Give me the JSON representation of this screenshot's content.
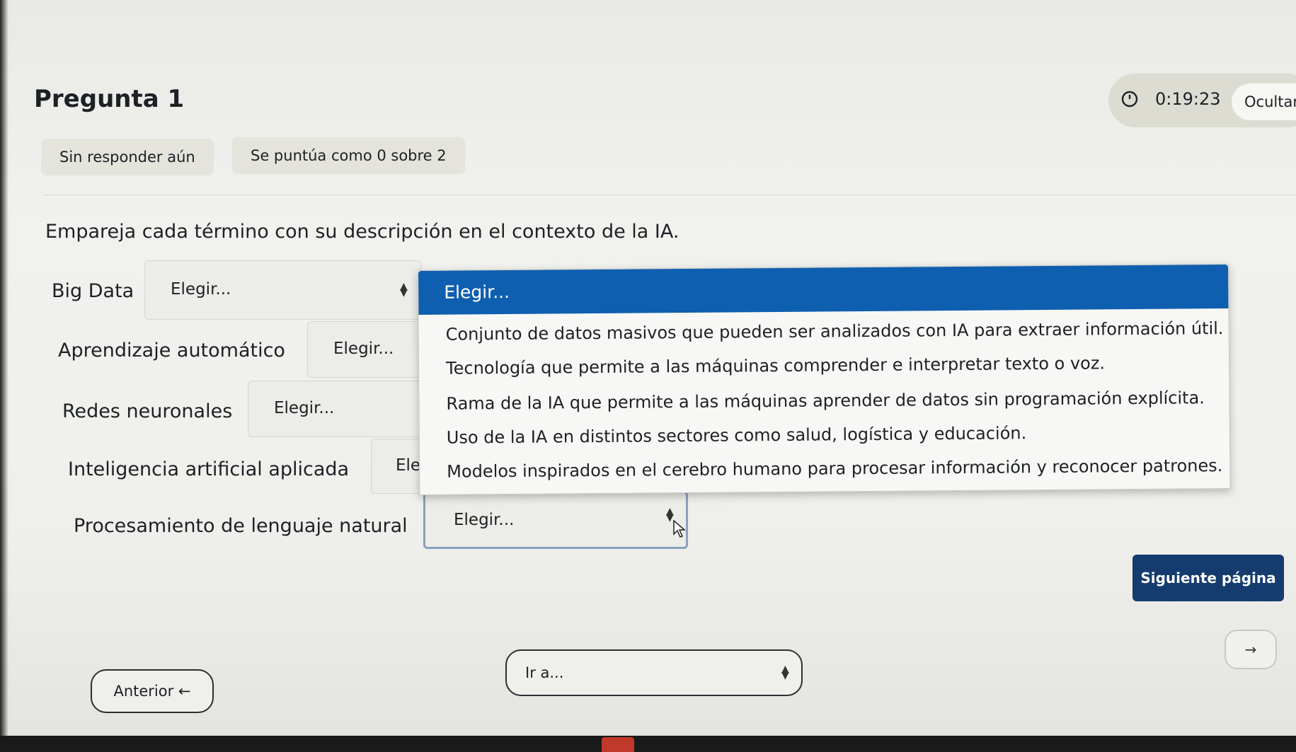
{
  "question": {
    "title": "Pregunta 1",
    "status": "Sin responder aún",
    "grade": "Se puntúa como 0 sobre 2",
    "instruction": "Empareja cada término con su descripción en el contexto de la IA."
  },
  "timer": {
    "value": "0:19:23",
    "hide_label": "Ocultar",
    "icon": "clock-icon"
  },
  "match": {
    "placeholder": "Elegir...",
    "rows": [
      {
        "term": "Big Data",
        "selected": "Elegir..."
      },
      {
        "term": "Aprendizaje automático",
        "selected": "Elegir..."
      },
      {
        "term": "Redes neuronales",
        "selected": "Elegir..."
      },
      {
        "term": "Inteligencia artificial aplicada",
        "selected": "Eleg"
      },
      {
        "term": "Procesamiento de lenguaje natural",
        "selected": "Elegir..."
      }
    ]
  },
  "dropdown": {
    "highlighted": "Elegir...",
    "options": [
      "Conjunto de datos masivos que pueden ser analizados con IA para extraer información útil.",
      "Tecnología que permite a las máquinas comprender e interpretar texto o voz.",
      "Rama de la IA que permite a las máquinas aprender de datos sin programación explícita.",
      "Uso de la IA en distintos sectores como salud, logística y educación.",
      "Modelos inspirados en el cerebro humano para procesar información y reconocer patrones."
    ]
  },
  "nav": {
    "next": "Siguiente página",
    "next_arrow": "→",
    "prev": "Anterior ←",
    "jump_placeholder": "Ir a..."
  },
  "colors": {
    "accent": "#0f5fb0",
    "next_button": "#143c6e"
  }
}
